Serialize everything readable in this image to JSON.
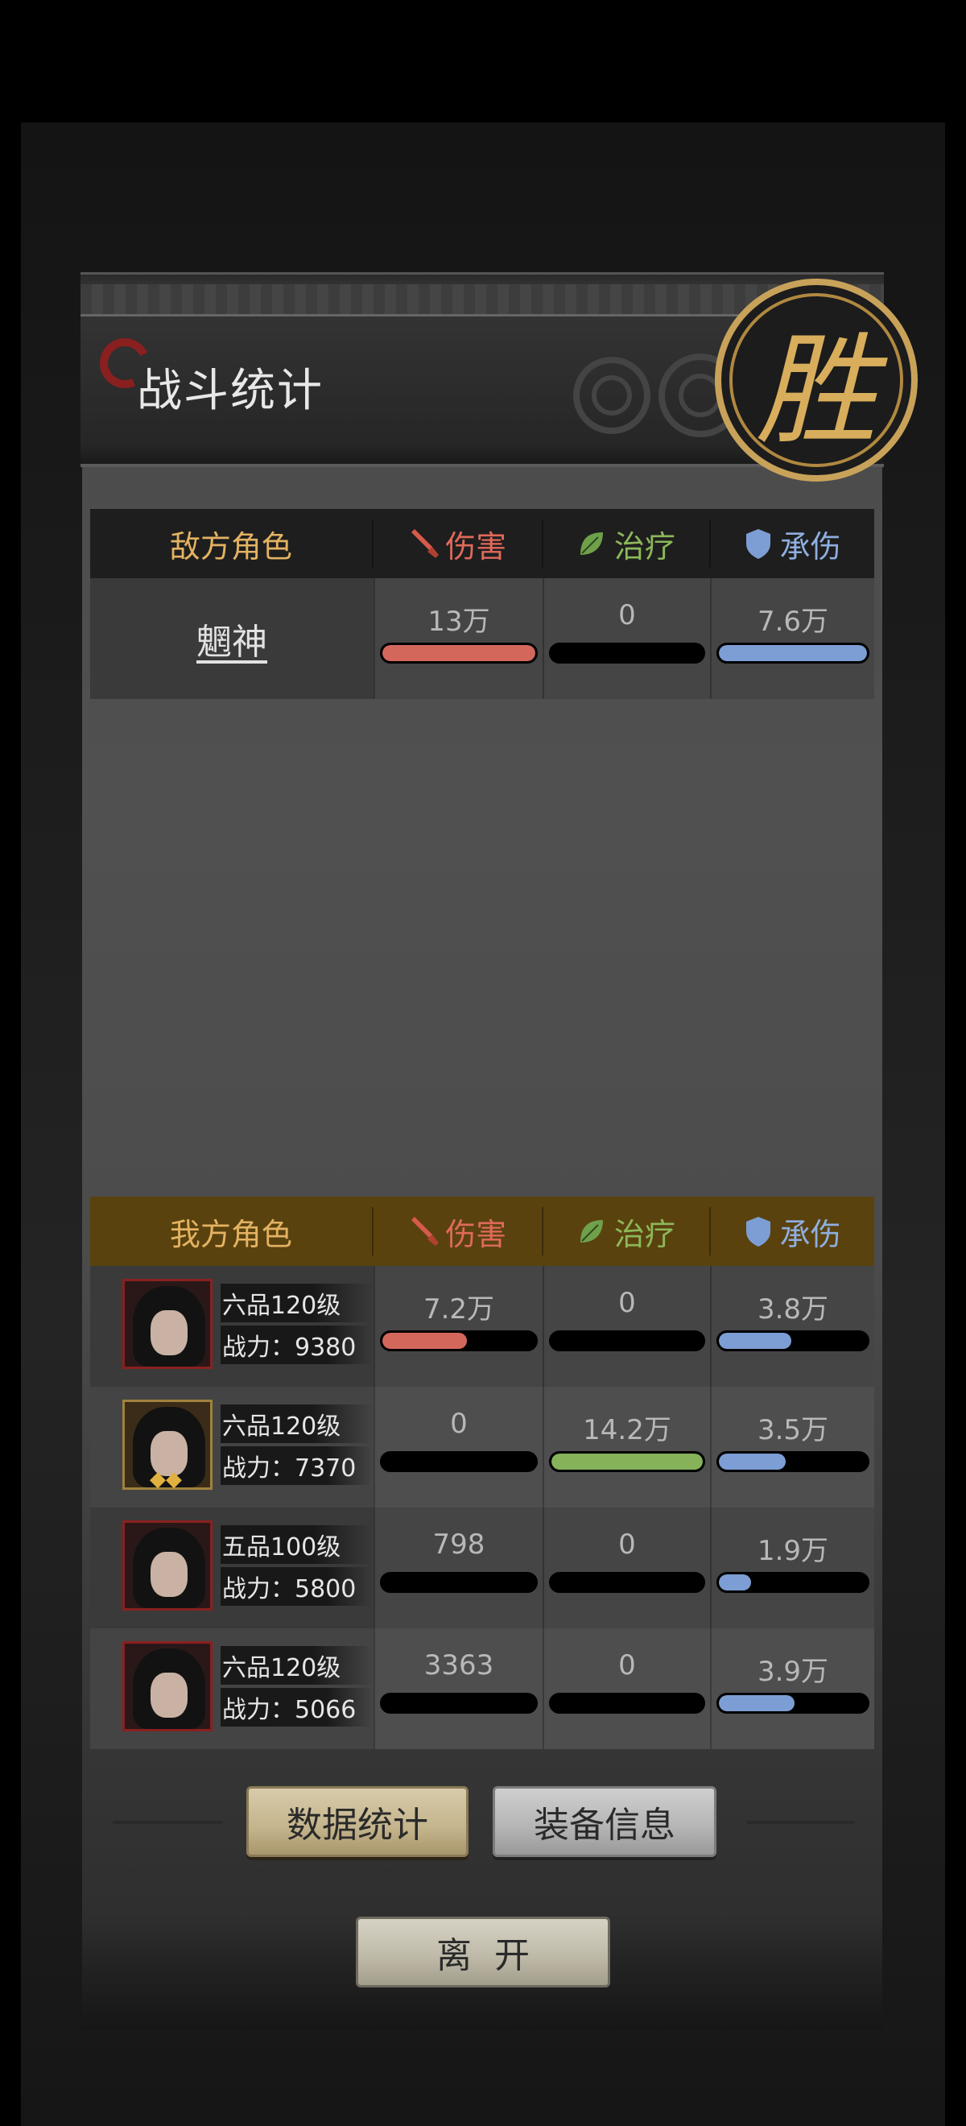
{
  "header": {
    "title": "战斗统计",
    "result_seal": "胜"
  },
  "columns": {
    "damage": "伤害",
    "healing": "治疗",
    "tanked": "承伤"
  },
  "enemy": {
    "heading": "敌方角色",
    "rows": [
      {
        "name": "魍神",
        "damage": "13万",
        "healing": "0",
        "tanked": "7.6万",
        "damage_frac": 1.0,
        "healing_frac": 0.0,
        "tanked_frac": 1.0
      }
    ]
  },
  "ally": {
    "heading": "我方角色",
    "rows": [
      {
        "level": "六品120级",
        "power": "战力：9380",
        "damage": "7.2万",
        "healing": "0",
        "tanked": "3.8万",
        "damage_frac": 0.55,
        "healing_frac": 0.0,
        "tanked_frac": 0.49
      },
      {
        "level": "六品120级",
        "power": "战力：7370",
        "damage": "0",
        "healing": "14.2万",
        "tanked": "3.5万",
        "damage_frac": 0.0,
        "healing_frac": 1.0,
        "tanked_frac": 0.45
      },
      {
        "level": "五品100级",
        "power": "战力：5800",
        "damage": "798",
        "healing": "0",
        "tanked": "1.9万",
        "damage_frac": 0.0,
        "healing_frac": 0.0,
        "tanked_frac": 0.22
      },
      {
        "level": "六品120级",
        "power": "战力：5066",
        "damage": "3363",
        "healing": "0",
        "tanked": "3.9万",
        "damage_frac": 0.0,
        "healing_frac": 0.0,
        "tanked_frac": 0.51
      }
    ]
  },
  "buttons": {
    "data_stats": "数据统计",
    "equipment_info": "装备信息",
    "leave": "离开"
  },
  "colors": {
    "damage": "#d4675c",
    "healing": "#86b25a",
    "tanked": "#7d9ed4",
    "gold_text": "#e3b262"
  },
  "icons": {
    "damage": "sword-icon",
    "healing": "leaf-icon",
    "tanked": "shield-icon"
  }
}
